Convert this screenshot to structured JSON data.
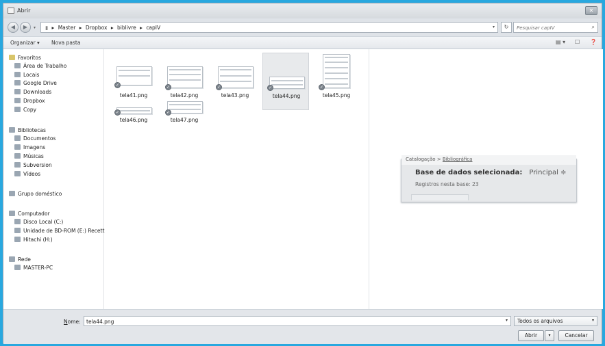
{
  "window": {
    "title": "Abrir",
    "close_glyph": "✕"
  },
  "address": {
    "path": [
      "Master",
      "Dropbox",
      "biblivre",
      "capIV"
    ],
    "separator": "▸",
    "search_placeholder": "Pesquisar capIV"
  },
  "toolbar": {
    "organize_label": "Organizar ▾",
    "new_folder_label": "Nova pasta"
  },
  "nav": {
    "favorites": {
      "header": "Favoritos",
      "items": [
        "Área de Trabalho",
        "Locais",
        "Google Drive",
        "Downloads",
        "Dropbox",
        "Copy"
      ]
    },
    "libraries": {
      "header": "Bibliotecas",
      "items": [
        "Documentos",
        "Imagens",
        "Músicas",
        "Subversion",
        "Vídeos"
      ]
    },
    "homegroup": "Grupo doméstico",
    "computer": {
      "header": "Computador",
      "items": [
        "Disco Local (C:)",
        "Unidade de BD-ROM (E:) Recett",
        "Hitachi (H:)"
      ]
    },
    "network": {
      "header": "Rede",
      "items": [
        "MASTER-PC"
      ]
    }
  },
  "files": [
    {
      "name": "tela41.png",
      "selected": false
    },
    {
      "name": "tela42.png",
      "selected": false
    },
    {
      "name": "tela43.png",
      "selected": false
    },
    {
      "name": "tela44.png",
      "selected": true
    },
    {
      "name": "tela45.png",
      "selected": false
    },
    {
      "name": "tela46.png",
      "selected": false
    },
    {
      "name": "tela47.png",
      "selected": false
    }
  ],
  "preview": {
    "breadcrumb_root": "Catalogação",
    "breadcrumb_sep": " > ",
    "breadcrumb_leaf": "Bibliográfica",
    "title": "Base de dados selecionada:",
    "selected_base": "Principal ≑",
    "records": "Registros nesta base: 23"
  },
  "bottom": {
    "name_label_u": "N",
    "name_label_rest": "ome:",
    "name_value": "tela44.png",
    "filetype": "Todos os arquivos",
    "open_label": "Abrir",
    "cancel_label": "Cancelar"
  }
}
